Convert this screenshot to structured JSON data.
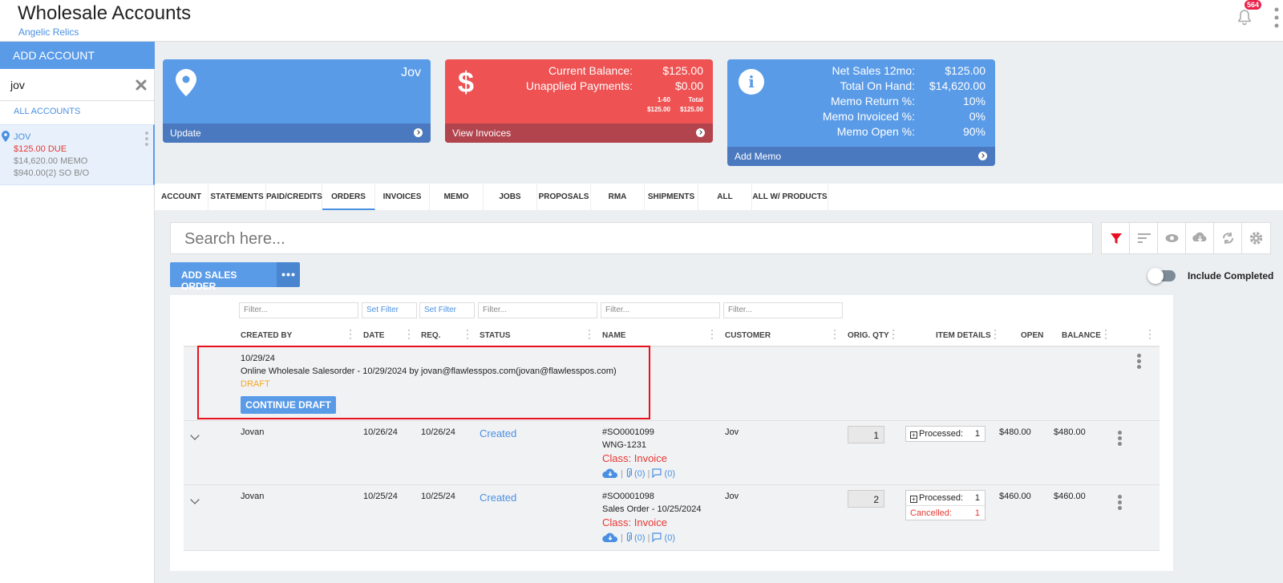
{
  "header": {
    "title": "Wholesale Accounts",
    "subtitle": "Angelic Relics",
    "notification_count": "564"
  },
  "sidebar": {
    "add_account": "ADD ACCOUNT",
    "search_value": "jov",
    "all_accounts": "ALL ACCOUNTS",
    "account": {
      "name": "JOV",
      "due": "$125.00 DUE",
      "memo": "$14,620.00 MEMO",
      "so": "$940.00(2) SO B/O"
    }
  },
  "cards": {
    "account": {
      "name": "Jov",
      "footer": "Update"
    },
    "balance": {
      "rows": [
        {
          "label": "Current Balance:",
          "value": "$125.00"
        },
        {
          "label": "Unapplied Payments:",
          "value": "$0.00"
        }
      ],
      "aging": {
        "h1": "1-60",
        "h2": "Total",
        "v1": "$125.00",
        "v2": "$125.00"
      },
      "footer": "View Invoices"
    },
    "memo": {
      "rows": [
        {
          "label": "Net Sales 12mo:",
          "value": "$125.00"
        },
        {
          "label": "Total On Hand:",
          "value": "$14,620.00"
        },
        {
          "label": "Memo Return %:",
          "value": "10%"
        },
        {
          "label": "Memo Invoiced %:",
          "value": "0%"
        },
        {
          "label": "Memo Open %:",
          "value": "90%"
        }
      ],
      "footer": "Add Memo"
    }
  },
  "tabs": [
    "ACCOUNT",
    "STATEMENTS",
    "PAID/CREDITS",
    "ORDERS",
    "INVOICES",
    "MEMO",
    "JOBS",
    "PROPOSALS",
    "RMA",
    "SHIPMENTS",
    "ALL",
    "ALL W/ PRODUCTS"
  ],
  "active_tab": "ORDERS",
  "search": {
    "placeholder": "Search here..."
  },
  "actions": {
    "add_sales_order": "ADD SALES ORDER",
    "include_completed": "Include Completed"
  },
  "grid": {
    "filters": {
      "text": "Filter...",
      "set_filter": "Set Filter"
    },
    "columns": [
      "CREATED BY",
      "DATE",
      "REQ.",
      "STATUS",
      "NAME",
      "CUSTOMER",
      "ORIG. QTY",
      "ITEM DETAILS",
      "OPEN",
      "BALANCE"
    ],
    "draft": {
      "date": "10/29/24",
      "description": "Online Wholesale Salesorder - 10/29/2024 by jovan@flawlesspos.com(jovan@flawlesspos.com)",
      "status": "DRAFT",
      "button": "CONTINUE DRAFT"
    },
    "rows": [
      {
        "created_by": "Jovan",
        "date": "10/26/24",
        "req": "10/26/24",
        "status": "Created",
        "number": "#SO0001099",
        "name": "WNG-1231",
        "class": "Class: Invoice",
        "customer": "Jov",
        "qty": "1",
        "processed_label": "Processed:",
        "processed": "1",
        "open": "$480.00",
        "balance": "$480.00",
        "attachments": "(0)",
        "comments": "(0)"
      },
      {
        "created_by": "Jovan",
        "date": "10/25/24",
        "req": "10/25/24",
        "status": "Created",
        "number": "#SO0001098",
        "name": "Sales Order - 10/25/2024",
        "class": "Class: Invoice",
        "customer": "Jov",
        "qty": "2",
        "processed_label": "Processed:",
        "processed": "1",
        "cancelled_label": "Cancelled:",
        "cancelled": "1",
        "open": "$460.00",
        "balance": "$460.00",
        "attachments": "(0)",
        "comments": "(0)"
      }
    ]
  }
}
